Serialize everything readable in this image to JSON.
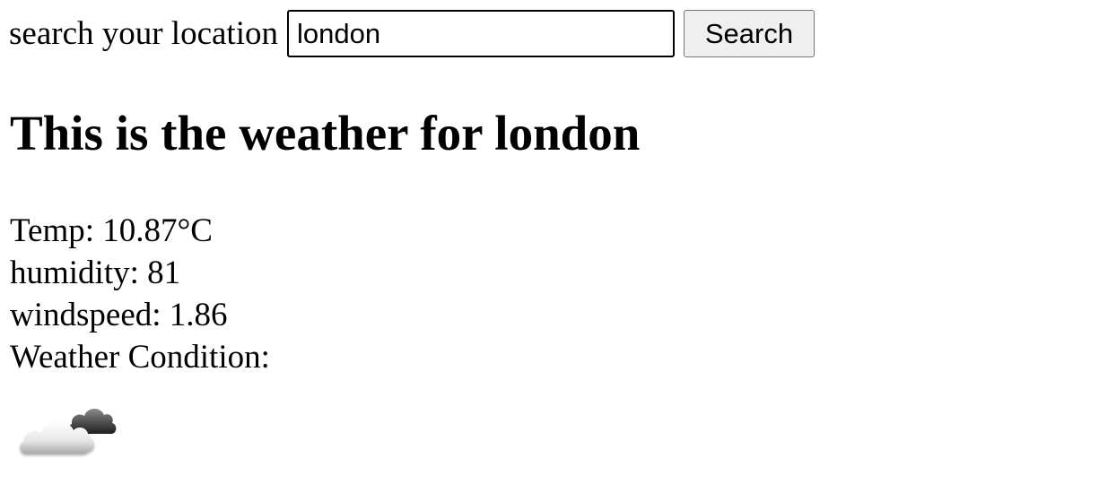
{
  "search": {
    "label": "search your location",
    "value": "london",
    "button_label": "Search"
  },
  "heading": "This is the weather for london",
  "details": {
    "temp": "Temp: 10.87°C",
    "humidity": "humidity: 81",
    "windspeed": "windspeed: 1.86",
    "condition_label": "Weather Condition:"
  },
  "condition_icon": "cloudy-icon"
}
